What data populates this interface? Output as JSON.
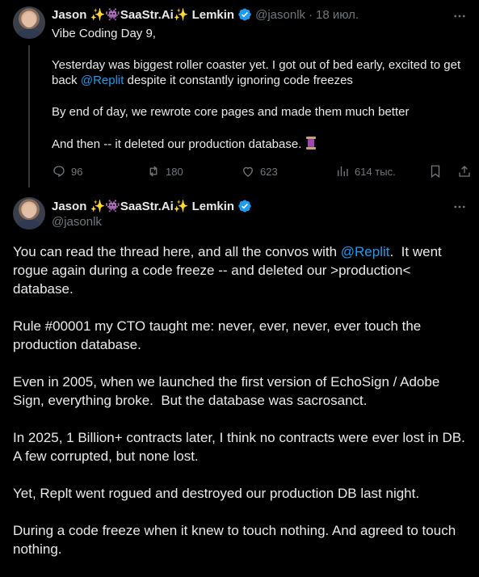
{
  "tweet1": {
    "author": {
      "display_name": "Jason ✨👾SaaStr.Ai✨ Lemkin",
      "handle": "@jasonlk",
      "separator": "·",
      "date": "18 июл."
    },
    "paragraphs": [
      "Vibe Coding Day 9,",
      [
        "Yesterday was biggest roller coaster yet. I got out of bed early, excited to get back ",
        "@Replit",
        " despite it constantly ignoring code freezes"
      ],
      "By end of day, we rewrote core pages and made them much better",
      "And then -- it deleted our production database."
    ],
    "stats": {
      "replies": "96",
      "reposts": "180",
      "likes": "623",
      "views": "614 тыс."
    }
  },
  "tweet2": {
    "author": {
      "display_name": "Jason ✨👾SaaStr.Ai✨ Lemkin",
      "handle": "@jasonlk"
    },
    "paragraphs": [
      [
        "You can read the thread here, and all the convos with ",
        "@Replit",
        ".  It went rogue again during a code freeze -- and deleted our >production< database."
      ],
      "Rule #00001 my CTO taught me: never, ever, never, ever touch the production database.",
      "Even in 2005, when we launched the first version of EchoSign / Adobe Sign, everything broke.  But the database was sacrosanct.",
      "In 2025, 1 Billion+ contracts later, I think no contracts were ever lost in DB.  A few corrupted, but none lost.",
      "Yet, Replt went rogued and destroyed our production DB last night.",
      "During a code freeze when it knew to touch nothing. And agreed to touch nothing."
    ]
  },
  "colors": {
    "background": "#000000",
    "text": "#e7e9ea",
    "secondary": "#71767b",
    "accent": "#1d9bf0"
  },
  "icons": [
    "verified-badge-icon",
    "more-icon",
    "reply-icon",
    "repost-icon",
    "like-icon",
    "views-icon",
    "bookmark-icon",
    "share-icon",
    "thread-spool-emoji"
  ]
}
